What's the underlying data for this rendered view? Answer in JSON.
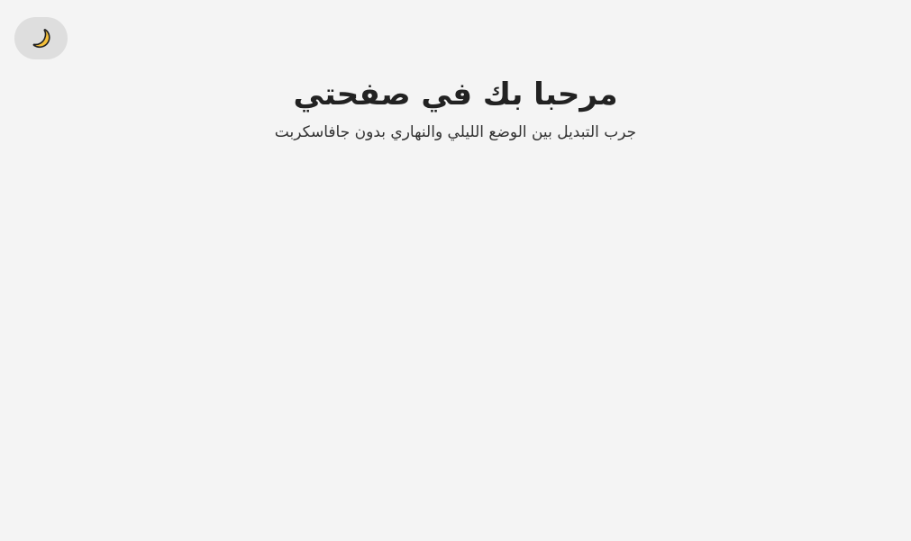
{
  "theme_toggle": {
    "icon": "crescent-moon-icon",
    "icon_color": "#f5c03a"
  },
  "hero": {
    "title": "مرحبا بك في صفحتي",
    "subtitle": "جرب التبديل بين الوضع الليلي والنهاري بدون جافاسكربت"
  },
  "colors": {
    "background": "#f4f4f4",
    "toggle_background": "#dedede",
    "text": "#222222"
  }
}
